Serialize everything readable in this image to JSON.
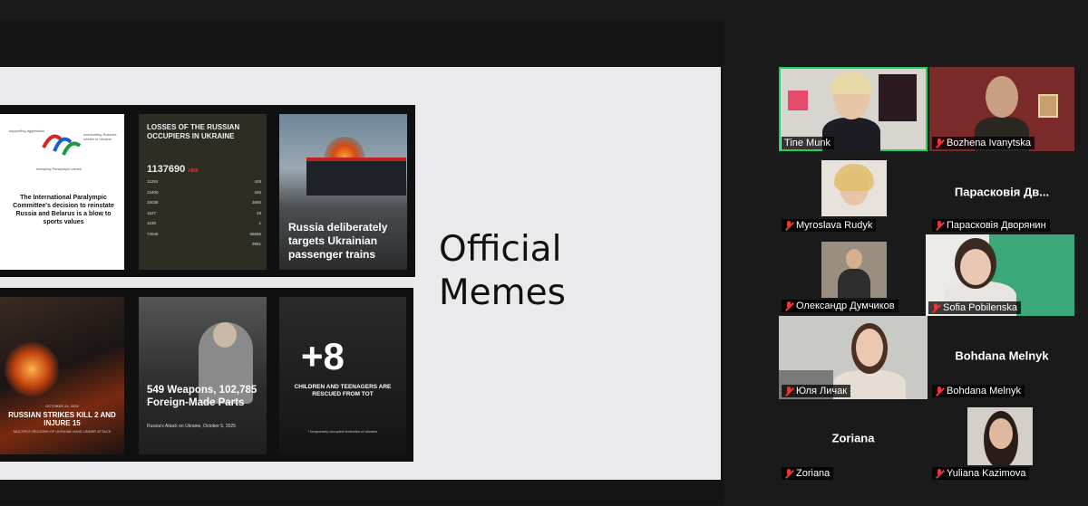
{
  "slide": {
    "title": "Official\nMemes",
    "cards": {
      "c1": {
        "top_left": "supporting aggression",
        "top_right": "overlooking Russia's crimes in Ukraine",
        "under_logo": "betraying Paralympic values",
        "heading": "The International Paralympic Committee's decision to reinstate Russia and Belarus is a blow to sports values"
      },
      "c2": {
        "title": "LOSSES OF THE RUSSIAN OCCUPIERS IN UKRAINE",
        "big_number": "1137690",
        "big_delta": "+920",
        "stats": [
          [
            "11293",
            "428"
          ],
          [
            "23400",
            "346"
          ],
          [
            "34036",
            "3660"
          ],
          [
            "1527",
            "28"
          ],
          [
            "1230",
            "1"
          ],
          [
            "74946",
            "65655"
          ],
          [
            "",
            "3981"
          ]
        ]
      },
      "c3": {
        "caption": "Russia deliberately targets Ukrainian passenger trains"
      },
      "c4": {
        "date": "OCTOBER 24, 2025",
        "heading": "RUSSIAN STRIKES KILL 2 AND INJURE 15",
        "sub": "MULTIPLE REGIONS OF UKRAINE HAVE UNDER ATTACK"
      },
      "c5": {
        "heading": "549 Weapons, 102,785 Foreign-Made Parts",
        "sub": "Russia's Attack on Ukraine, October 5, 2025"
      },
      "c6": {
        "big": "+8",
        "heading": "CHILDREN AND TEENAGERS ARE RESCUED FROM TOT",
        "sub": "* temporarily occupied territories of Ukraine"
      }
    }
  },
  "participants": [
    {
      "name": "Tine Munk",
      "muted": false,
      "video": true
    },
    {
      "name": "Bozhena Ivanytska",
      "muted": true,
      "video": true
    },
    {
      "name": "Myroslava Rudyk",
      "muted": true,
      "video": true
    },
    {
      "name": "Парасковія Дворянин",
      "muted": true,
      "video": false,
      "display_name": "Парасковія Дв..."
    },
    {
      "name": "Олександр Думчиков",
      "muted": true,
      "video": true
    },
    {
      "name": "Sofia Pobilenska",
      "muted": true,
      "video": true
    },
    {
      "name": "Юля Личак",
      "muted": true,
      "video": true
    },
    {
      "name": "Bohdana Melnyk",
      "muted": true,
      "video": false,
      "display_name": "Bohdana Melnyk"
    },
    {
      "name": "Zoriana",
      "muted": true,
      "video": false,
      "display_name": "Zoriana"
    },
    {
      "name": "Yuliana Kazimova",
      "muted": true,
      "video": true
    }
  ],
  "colors": {
    "active_speaker": "#23d160",
    "muted_icon": "#e33333"
  }
}
